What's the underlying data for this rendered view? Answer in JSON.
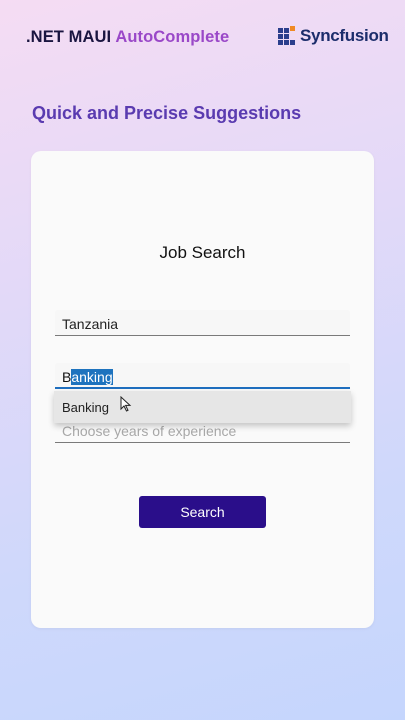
{
  "header": {
    "title_part1": ".NET MAUI",
    "title_part2": "AutoComplete",
    "logo_text": "Syncfusion",
    "logo_icon": "syncfusion-grid-logo"
  },
  "subtitle": "Quick and Precise Suggestions",
  "card": {
    "title": "Job Search",
    "country_field": {
      "value": "Tanzania"
    },
    "industry_field": {
      "typed": "B",
      "selected_completion": "anking"
    },
    "suggestions": [
      "Banking"
    ],
    "experience_field": {
      "placeholder": "Choose years of experience"
    },
    "search_button": "Search"
  },
  "colors": {
    "accent_purple": "#5a3bb0",
    "title_highlight": "#9a48c8",
    "button": "#2a0e8a",
    "focus_underline": "#1f6fbf",
    "selection": "#1e73be"
  }
}
